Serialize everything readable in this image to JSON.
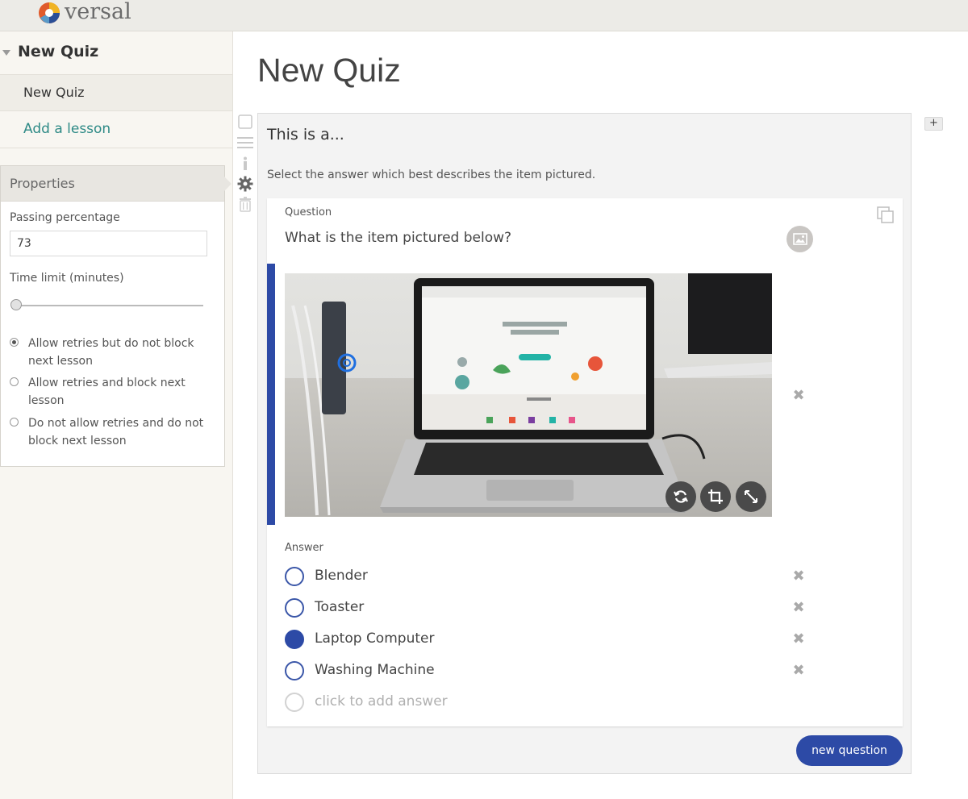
{
  "app": {
    "logo_text": "versal"
  },
  "sidebar": {
    "course_title": "New Quiz",
    "lesson_item": "New Quiz",
    "add_lesson": "Add a lesson"
  },
  "properties": {
    "title": "Properties",
    "passing_label": "Passing percentage",
    "passing_value": "73",
    "time_limit_label": "Time limit (minutes)",
    "time_limit_level": 0,
    "retry_options": [
      {
        "label": "Allow retries but do not block next lesson",
        "selected": true
      },
      {
        "label": "Allow retries and block next lesson",
        "selected": false
      },
      {
        "label": "Do not allow retries and do not block next lesson",
        "selected": false
      }
    ]
  },
  "main": {
    "page_title": "New Quiz",
    "quiz_title": "This is a...",
    "quiz_description": "Select the answer which best describes the item pictured.",
    "question_label": "Question",
    "question_text": "What is the item pictured below?",
    "answer_label": "Answer",
    "answers": [
      {
        "text": "Blender",
        "selected": false
      },
      {
        "text": "Toaster",
        "selected": false
      },
      {
        "text": "Laptop Computer",
        "selected": true
      },
      {
        "text": "Washing Machine",
        "selected": false
      }
    ],
    "add_answer_placeholder": "click to add answer",
    "new_question_label": "new question",
    "add_note_label": "+"
  },
  "colors": {
    "accent_blue": "#2d4aa6",
    "link_teal": "#2e8a86",
    "sidebar_bg": "#f8f6f1",
    "topbar_bg": "#ecebe7"
  },
  "icons": {
    "tools": [
      "checkbox-icon",
      "drag-handle-icon",
      "info-icon",
      "gear-icon",
      "trash-icon"
    ],
    "photo_controls": [
      "replace-image-icon",
      "crop-icon",
      "fullscreen-icon"
    ],
    "question_controls": [
      "duplicate-icon",
      "image-icon",
      "remove-icon"
    ]
  }
}
